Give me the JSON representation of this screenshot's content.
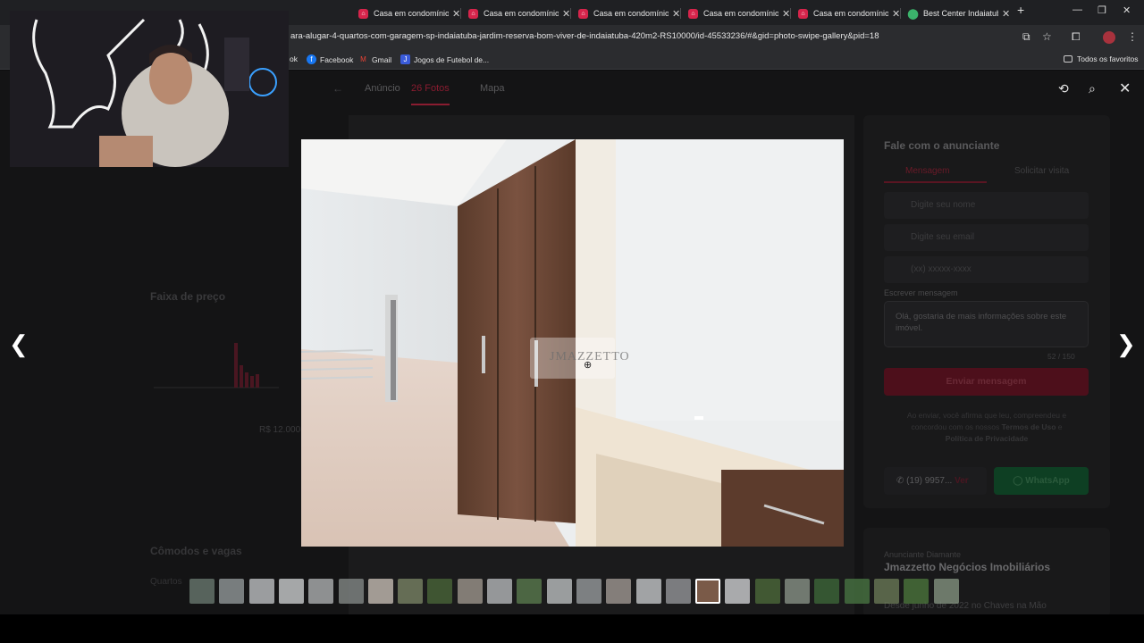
{
  "browser": {
    "tabs": [
      {
        "label": "Casa em condomínio",
        "icon": "property-site-icon"
      },
      {
        "label": "Casa em condomínio",
        "icon": "property-site-icon"
      },
      {
        "label": "Casa em condomínio",
        "icon": "property-site-icon"
      },
      {
        "label": "Casa em condomínio",
        "icon": "property-site-icon"
      },
      {
        "label": "Casa em condomínio",
        "icon": "property-site-icon"
      },
      {
        "label": "Casa em condomínio",
        "icon": "property-site-icon"
      },
      {
        "label": "Best Center Indaiatub",
        "icon": "maps-pin-icon"
      }
    ],
    "url": "ara-alugar-4-quartos-com-garagem-sp-indaiatuba-jardim-reserva-bom-viver-de-indaiatuba-420m2-RS10000/id-45533236/#&gid=photo-swipe-gallery&pid=18",
    "bookmarks": [
      {
        "label": "Facebook",
        "color": "#1877f2",
        "glyph": "f"
      },
      {
        "label": "Gmail",
        "color": "#ea4335",
        "glyph": "M"
      },
      {
        "label": "Jogos de Futebol de...",
        "color": "#3a5bd9",
        "glyph": "J"
      }
    ],
    "bookmarks_truncated_left": "ok",
    "all_favorites": "Todos os favoritos"
  },
  "gallery": {
    "tabs": [
      "Anúncio",
      "26 Fotos",
      "Mapa"
    ],
    "active_tab": "26 Fotos",
    "watermark": "JMAZZETTO",
    "thumbnail_count": 26,
    "selected_thumbnail": 18
  },
  "contact_panel": {
    "title": "Fale com o anunciante",
    "tab_message": "Mensagem",
    "tab_visit": "Solicitar visita",
    "name_placeholder": "Digite seu nome",
    "email_placeholder": "Digite seu email",
    "phone_placeholder": "(xx) xxxxx-xxxx",
    "message_label": "Escrever mensagem",
    "message_value": "Olá, gostaria de mais informações sobre este imóvel.",
    "char_count": "52 / 150",
    "send_label": "Enviar mensagem",
    "disclaimer": "Ao enviar, você afirma que leu, compreendeu e concordou com os nossos",
    "terms": "Termos de Uso",
    "and": "e",
    "privacy": "Política de Privacidade",
    "phone": "(19) 9957...",
    "phone_see": "Ver",
    "whatsapp": "WhatsApp"
  },
  "advertiser": {
    "badge": "Anunciante Diamante",
    "name": "Jmazzetto Negócios Imobiliários",
    "since": "Desde junho de 2022 no Chaves na Mão"
  },
  "background_left": {
    "price_range": "Faixa de preço",
    "price_value": "R$ 12.000",
    "rooms_title": "Cômodos e vagas",
    "rooms_label": "Quartos"
  },
  "colors": {
    "accent": "#8a1c30",
    "whatsapp": "#25d366"
  }
}
